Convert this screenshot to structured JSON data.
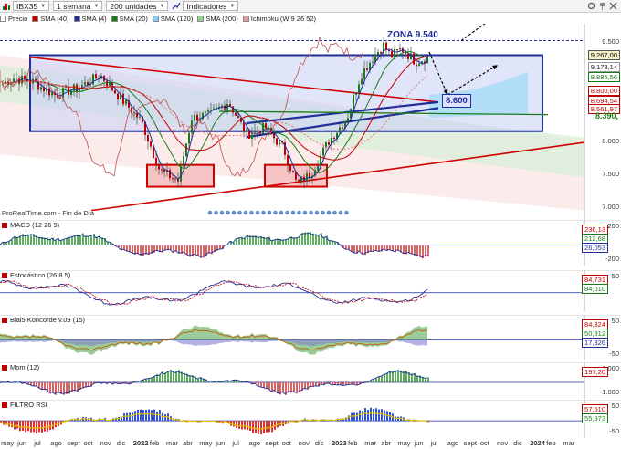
{
  "toolbar": {
    "symbol": "IBX35",
    "period": "1 semana",
    "units": "200 unidades",
    "indicators": "Indicadores"
  },
  "legend": [
    {
      "label": "Precio",
      "color": "#ffffff"
    },
    {
      "label": "SMA (40)",
      "color": "#c00000"
    },
    {
      "label": "SMA (4)",
      "color": "#1f2f9a"
    },
    {
      "label": "SMA (20)",
      "color": "#1a7a1a"
    },
    {
      "label": "SMA (120)",
      "color": "#7fd0ff"
    },
    {
      "label": "SMA (200)",
      "color": "#8fd08f"
    },
    {
      "label": "Ichimoku (W 9 26 52)",
      "color": "#e0a0a0"
    }
  ],
  "annotations": {
    "zona": "ZONA 9.540",
    "target": "8.600",
    "source": "ProRealTime.com - Fin de Día"
  },
  "main_axis": {
    "ticks": [
      "9.500",
      "9.000",
      "8.500",
      "8.000",
      "7.500",
      "7.000"
    ]
  },
  "price_boxes": {
    "last": "9.267,00",
    "p1": "9.173,14",
    "p2": "8.885,56",
    "p3": "8.800,00",
    "p4": "8.694,54",
    "p5": "8.561,97",
    "p6": "8.390,"
  },
  "indicators": [
    {
      "key": "macd",
      "title": "MACD (12 26 9)",
      "ticks": [
        "200",
        "-200"
      ],
      "values": [
        "236,13",
        "212,68",
        "26,053"
      ]
    },
    {
      "key": "estocastico",
      "title": "Estocástico (26 8 5)",
      "ticks": [
        "50"
      ],
      "values": [
        "84,731",
        "84,010"
      ]
    },
    {
      "key": "blai5",
      "title": "Blai5 Koncorde v.09 (15)",
      "ticks": [
        "50",
        "-50"
      ],
      "values": [
        "84,324",
        "50,812",
        "17,326"
      ]
    },
    {
      "key": "mom",
      "title": "Mom (12)",
      "ticks": [
        "1.000",
        "-1.000"
      ],
      "values": [
        "197,20"
      ]
    },
    {
      "key": "filtro",
      "title": "FILTRO RSI",
      "ticks": [
        "50",
        "-50"
      ],
      "values": [
        "57,510",
        "55,973"
      ]
    }
  ],
  "x_axis": [
    {
      "label": "may"
    },
    {
      "label": "jun"
    },
    {
      "label": "jul"
    },
    {
      "label": "ago"
    },
    {
      "label": "sept"
    },
    {
      "label": "oct"
    },
    {
      "label": "nov"
    },
    {
      "label": "dic"
    },
    {
      "label": "2022",
      "year": true
    },
    {
      "label": "feb"
    },
    {
      "label": "mar"
    },
    {
      "label": "abr"
    },
    {
      "label": "may"
    },
    {
      "label": "jun"
    },
    {
      "label": "jul"
    },
    {
      "label": "ago"
    },
    {
      "label": "sept"
    },
    {
      "label": "oct"
    },
    {
      "label": "nov"
    },
    {
      "label": "dic"
    },
    {
      "label": "2023",
      "year": true
    },
    {
      "label": "feb"
    },
    {
      "label": "mar"
    },
    {
      "label": "abr"
    },
    {
      "label": "may"
    },
    {
      "label": "jun"
    },
    {
      "label": "jul"
    },
    {
      "label": "ago"
    },
    {
      "label": "sept"
    },
    {
      "label": "oct"
    },
    {
      "label": "nov"
    },
    {
      "label": "dic"
    },
    {
      "label": "2024",
      "year": true
    },
    {
      "label": "feb"
    },
    {
      "label": "mar"
    }
  ],
  "colors": {
    "accent_blue": "#1f2f9a",
    "sma40": "#c00000",
    "sma20": "#1a7a1a",
    "bull": "#1a7a1a",
    "bear": "#c00000"
  }
}
